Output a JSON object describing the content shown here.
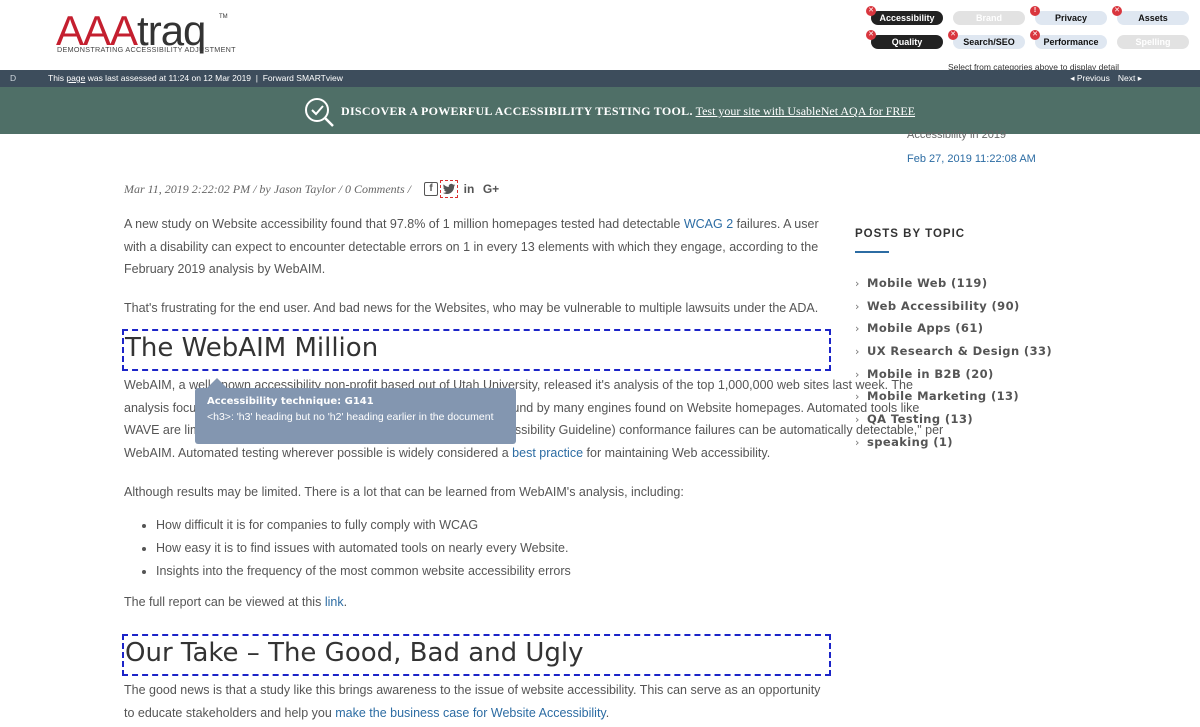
{
  "header": {
    "logo_main_a": "AAA",
    "logo_main_b": "traq",
    "logo_tm": "TM",
    "logo_tagline": "DEMONSTRATING ACCESSIBILITY ADJUSTMENT",
    "categories": {
      "accessibility": "Accessibility",
      "brand": "Brand",
      "privacy": "Privacy",
      "assets": "Assets",
      "quality": "Quality",
      "search_seo": "Search/SEO",
      "performance": "Performance",
      "spelling": "Spelling"
    },
    "categories_hint": "Select from categories above to display detail"
  },
  "toolbar": {
    "d": "D",
    "info_pre": "This ",
    "info_link": "page",
    "info_post": " was last assessed at 11:24 on 12 Mar 2019",
    "separator": "|",
    "forward": "Forward SMARTview",
    "previous": "◂ Previous",
    "next": "Next ▸"
  },
  "banner": {
    "bold": "DISCOVER A POWERFUL ACCESSIBILITY TESTING TOOL.",
    "link": "Test your site with UsableNet AQA for FREE"
  },
  "article": {
    "meta": "Mar 11, 2019 2:22:02 PM /   by Jason Taylor /  0 Comments  /",
    "p1_a": "A new study on Website accessibility found that 97.8% of 1 million homepages tested had detectable ",
    "p1_link": "WCAG 2",
    "p1_b": " failures.  A user with a disability can expect to encounter detectable errors on 1 in every 13 elements with which they engage, according to the February 2019 analysis by WebAIM.",
    "p2": "That's frustrating for the end user. And bad news for the Websites, who may be vulnerable to multiple lawsuits under the ADA.",
    "h1": "The WebAIM Million",
    "p3_line1": "WebAIM, a well-known accessibility non-profit based out of Utah University, released it's analysis of the top 1,000,000 web sites last week. The",
    "p3_line2": "analysis focused on the automatically detectable accessibility errors found by many engines found on Website homepages. Automated tools like",
    "p3_line3": "WAVE are limited in that only about 30% of WCAG (Web Content Accessibility Guideline) conformance failures can be automatically detectable,\" per",
    "p3_line4_a": "WebAIM.  Automated testing wherever possible is widely considered a ",
    "p3_line4_link": "best practice",
    "p3_line4_b": " for maintaining Web accessibility.",
    "p4": "Although results may be limited. There is a lot that can be learned from WebAIM's analysis, including:",
    "bullets": [
      "How difficult it is for companies to fully comply with WCAG",
      "How easy it is to find issues with automated tools on nearly every Website.",
      "Insights into the frequency of the most common website accessibility errors"
    ],
    "p5_a": "The full report can be viewed at this ",
    "p5_link": "link",
    "p5_b": ".",
    "h2": "Our Take – The Good, Bad and Ugly",
    "p6_a": "The good news is that a study like this brings awareness to the issue of website accessibility. This can serve as an opportunity to educate stakeholders and help you ",
    "p6_link": "make the business case for Website Accessibility",
    "p6_b": "."
  },
  "tooltip": {
    "title": "Accessibility technique: G141",
    "body": "<h3>: 'h3' heading but no 'h2' heading earlier in the document"
  },
  "sidebar": {
    "recent_title": "Accessibility in 2019",
    "recent_date": "Feb 27, 2019 11:22:08 AM",
    "posts_by_topic": "POSTS BY TOPIC",
    "topics": [
      "Mobile Web (119)",
      "Web Accessibility (90)",
      "Mobile Apps (61)",
      "UX Research & Design (33)",
      "Mobile in B2B (20)",
      "Mobile Marketing (13)",
      "QA Testing (13)",
      "speaking (1)"
    ]
  },
  "colors": {
    "brand_red": "#c41f2f",
    "toolbar": "#3d4d5c",
    "banner": "#4f6f67",
    "link": "#2c6ca3",
    "heading_outline": "#1c24c8",
    "tooltip": "#8396b0"
  }
}
